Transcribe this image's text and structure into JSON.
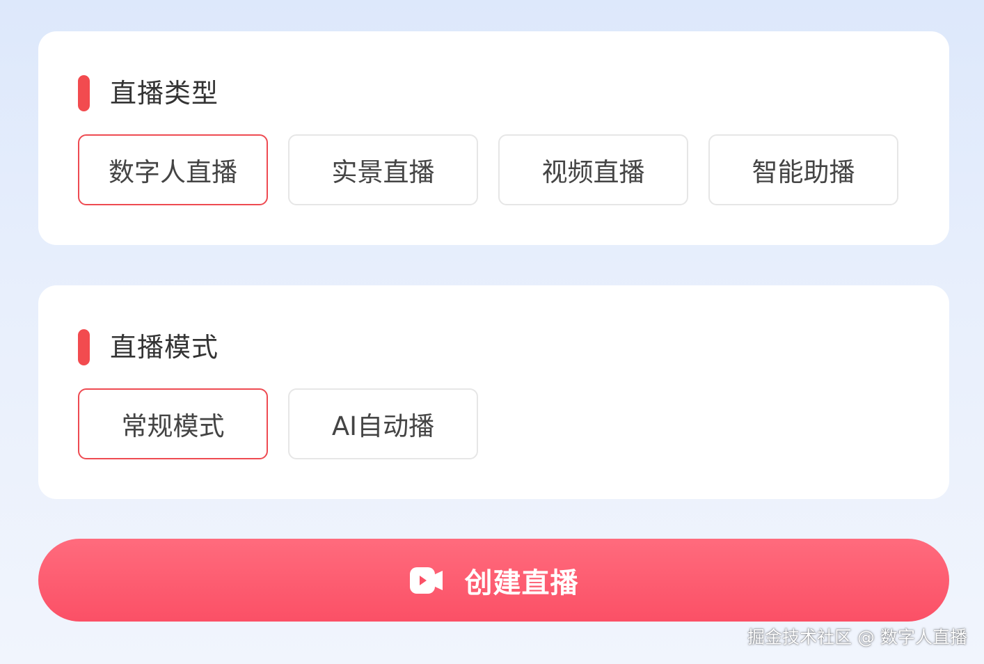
{
  "live_type": {
    "title": "直播类型",
    "options": [
      {
        "label": "数字人直播",
        "selected": true
      },
      {
        "label": "实景直播",
        "selected": false
      },
      {
        "label": "视频直播",
        "selected": false
      },
      {
        "label": "智能助播",
        "selected": false
      }
    ]
  },
  "live_mode": {
    "title": "直播模式",
    "options": [
      {
        "label": "常规模式",
        "selected": true
      },
      {
        "label": "AI自动播",
        "selected": false
      }
    ]
  },
  "create_button": {
    "label": "创建直播",
    "icon": "video-camera-icon"
  },
  "watermark": "掘金技术社区 @ 数字人直播",
  "colors": {
    "accent": "#f24b4f",
    "selected_border": "#ee4a51",
    "button_gradient_top": "#ff6b7d",
    "button_gradient_bottom": "#fb5066"
  }
}
